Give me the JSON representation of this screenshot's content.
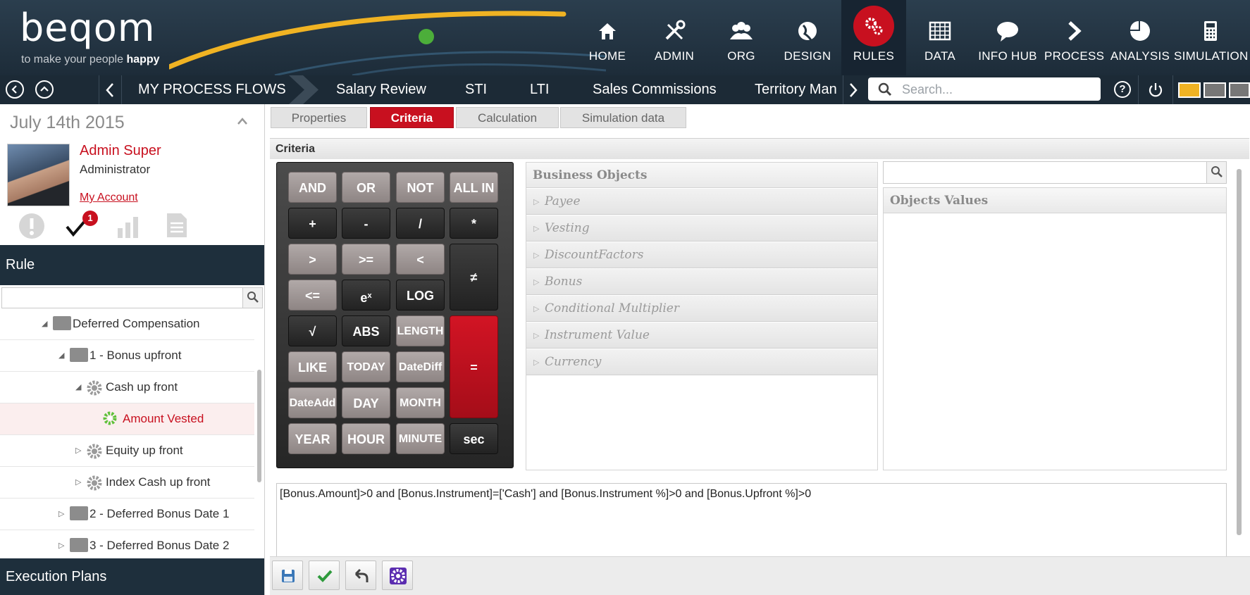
{
  "brand": {
    "logo": "beqom",
    "tagline_prefix": "to make your people",
    "tagline_bold": "happy"
  },
  "nav": [
    {
      "label": "HOME",
      "icon": "home-icon"
    },
    {
      "label": "ADMIN",
      "icon": "tools-icon"
    },
    {
      "label": "ORG",
      "icon": "people-icon"
    },
    {
      "label": "DESIGN",
      "icon": "globe-icon"
    },
    {
      "label": "RULES",
      "icon": "gears-icon"
    },
    {
      "label": "DATA",
      "icon": "grid-icon"
    },
    {
      "label": "INFO HUB",
      "icon": "speech-bubble-icon"
    },
    {
      "label": "PROCESS",
      "icon": "chevron-right-icon"
    },
    {
      "label": "ANALYSIS",
      "icon": "pie-chart-icon"
    },
    {
      "label": "SIMULATION",
      "icon": "calculator-icon"
    }
  ],
  "toolbar": {
    "crumbs": [
      "MY PROCESS FLOWS",
      "Salary Review",
      "STI",
      "LTI",
      "Sales Commissions",
      "Territory Man"
    ],
    "search_placeholder": "Search..."
  },
  "left": {
    "date": "July 14th 2015",
    "user_name": "Admin Super",
    "user_role": "Administrator",
    "account_link": "My Account",
    "notification_count": "1",
    "rule_section": "Rule",
    "exec_section": "Execution Plans",
    "tree": [
      {
        "label": "Deferred Compensation"
      },
      {
        "label": "1 - Bonus upfront"
      },
      {
        "label": "Cash up front"
      },
      {
        "label": "Amount Vested"
      },
      {
        "label": "Equity up front"
      },
      {
        "label": "Index Cash up front"
      },
      {
        "label": "2 - Deferred Bonus Date 1"
      },
      {
        "label": "3 - Deferred Bonus Date 2"
      }
    ]
  },
  "tabs": [
    "Properties",
    "Criteria",
    "Calculation",
    "Simulation data"
  ],
  "criteria_title": "Criteria",
  "calc": {
    "row1": [
      "AND",
      "OR",
      "NOT",
      "ALL IN"
    ],
    "row2": [
      "+",
      "-",
      "/",
      "*"
    ],
    "row3": [
      ">",
      ">=",
      "<"
    ],
    "row4": [
      "<=",
      "e",
      "x",
      "LOG"
    ],
    "neq": "≠",
    "row5": [
      "√",
      "ABS",
      "LENGTH"
    ],
    "row6": [
      "LIKE",
      "TODAY",
      "DateDiff"
    ],
    "eq": "=",
    "row7": [
      "DateAdd",
      "DAY",
      "MONTH"
    ],
    "row8": [
      "YEAR",
      "HOUR",
      "MINUTE",
      "sec"
    ]
  },
  "business_objects": {
    "title": "Business Objects",
    "items": [
      "Payee",
      "Vesting",
      "DiscountFactors",
      "Bonus",
      "Conditional Multiplier",
      "Instrument Value",
      "Currency"
    ]
  },
  "objects_values": {
    "title": "Objects Values"
  },
  "formula": "[Bonus.Amount]>0 and [Bonus.Instrument]=['Cash'] and [Bonus.Instrument %]>0 and [Bonus.Upfront %]>0",
  "colors": {
    "accent": "#c8101f",
    "header": "#23333f",
    "logo_arc": "#f0b323",
    "active_leaf": "#5fc13a"
  }
}
